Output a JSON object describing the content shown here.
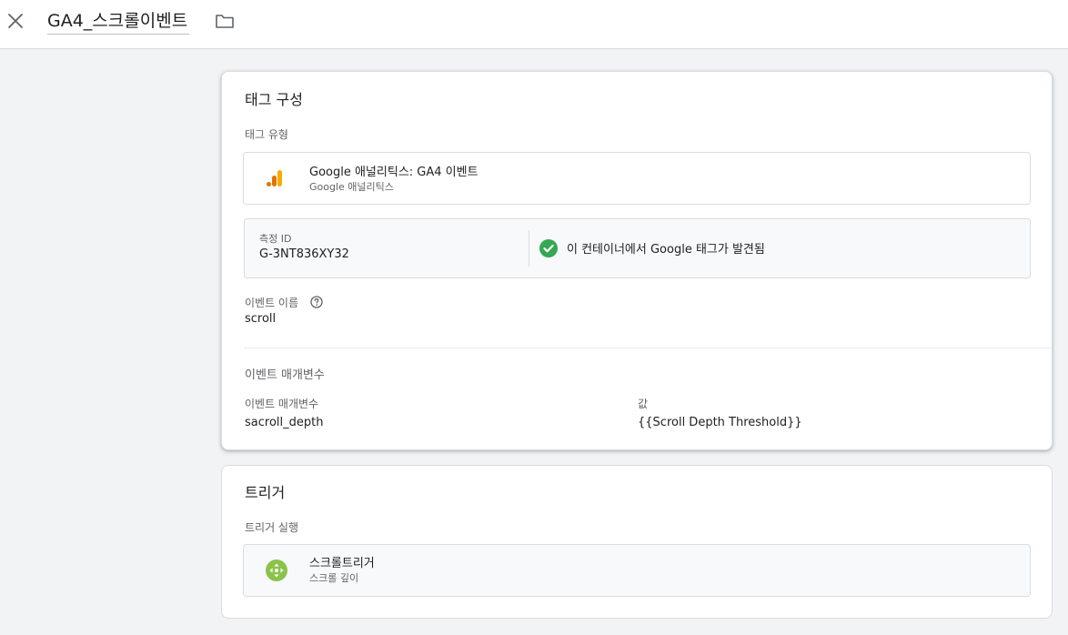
{
  "header": {
    "title": "GA4_스크롤이벤트",
    "close_icon": "close-icon",
    "folder_icon": "folder-icon"
  },
  "tag_config": {
    "title": "태그 구성",
    "tag_type_label": "태그 유형",
    "tag_type": {
      "name": "Google 애널리틱스: GA4 이벤트",
      "subtitle": "Google 애널리틱스",
      "icon": "analytics-icon"
    },
    "measurement": {
      "label": "측정 ID",
      "value": "G-3NT836XY32",
      "status": "이 컨테이너에서 Google 태그가 발견됨",
      "status_icon": "check-circle-icon"
    },
    "event_name": {
      "label": "이벤트 이름",
      "value": "scroll",
      "help_icon": "help-icon"
    },
    "event_params": {
      "title": "이벤트 매개변수",
      "col_param": "이벤트 매개변수",
      "col_value": "값",
      "rows": [
        {
          "param": "sacroll_depth",
          "value": "{{Scroll Depth Threshold}}"
        }
      ]
    }
  },
  "trigger": {
    "title": "트리거",
    "firing_label": "트리거 실행",
    "item": {
      "name": "스크롤트리거",
      "subtitle": "스크롤 깊이",
      "icon": "scroll-trigger-icon"
    }
  },
  "colors": {
    "accent_green": "#34a853",
    "trigger_green": "#8bc34a",
    "analytics_orange": "#f9ab00",
    "analytics_dark": "#e37400"
  }
}
